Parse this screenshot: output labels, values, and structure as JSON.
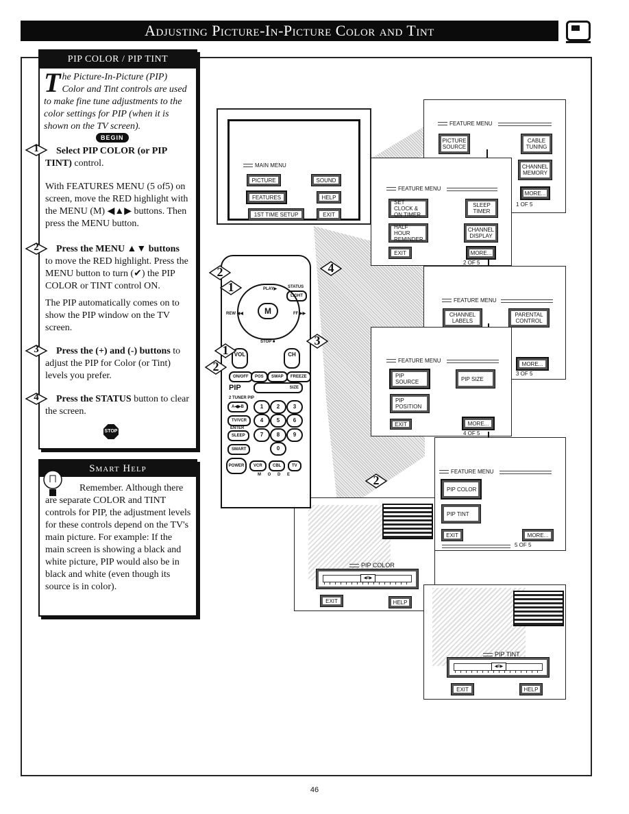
{
  "header": {
    "title": "Adjusting Picture-In-Picture Color and Tint",
    "icon": "tv-icon"
  },
  "instructions": {
    "title": "PIP COLOR / PIP TINT",
    "intro_dropcap": "T",
    "intro": "he Picture-In-Picture (PIP) Color and Tint controls are used to make fine tune adjustments to the color settings for PIP (when it is shown on the TV screen).",
    "begin_label": "BEGIN",
    "steps": [
      {
        "num": "1",
        "heading": "Select PIP COLOR (or PIP TINT)",
        "heading_rest": " control.",
        "body": "With FEATURES MENU (5 of5) on screen, move the RED highlight with the MENU (M) ◀▲▶ buttons. Then press the MENU button."
      },
      {
        "num": "2",
        "heading": "Press the MENU ▲▼ buttons",
        "body": "to move the RED highlight. Press the MENU button to turn (✔) the PIP COLOR or TINT control ON.",
        "body2": "The PIP automatically comes on to show the PIP window on the TV screen."
      },
      {
        "num": "3",
        "heading": "Press the (+) and (-) buttons",
        "heading_rest": " to adjust the PIP for Color (or Tint) levels you prefer."
      },
      {
        "num": "4",
        "heading": "Press the STATUS",
        "heading_rest": " button to clear the screen."
      }
    ],
    "stop_label": "STOP"
  },
  "smart_help": {
    "title": "Smart Help",
    "text": "Remember. Although there are separate COLOR and TINT controls for PIP, the adjustment levels for these controls depend on the TV's main picture. For example: If the main screen is showing a black and white picture, PIP would also be in black and white (even though its source is in color)."
  },
  "main_menu": {
    "title": "MAIN MENU",
    "buttons": [
      "PICTURE",
      "SOUND",
      "FEATURES",
      "HELP",
      "1ST TIME SETUP",
      "EXIT"
    ],
    "highlighted": "FEATURES"
  },
  "feature_menus": [
    {
      "title": "FEATURE MENU",
      "buttons": [
        "PICTURE SOURCE",
        "CABLE TUNING",
        "CHANNEL MEMORY",
        "MORE..."
      ],
      "pager": "1 OF 5",
      "highlighted": "MORE..."
    },
    {
      "title": "FEATURE MENU",
      "buttons": [
        "SET CLOCK & ON TIMER",
        "SLEEP TIMER",
        "HALF HOUR REMINDER",
        "CHANNEL DISPLAY",
        "EXIT",
        "MORE..."
      ],
      "pager": "2 OF 5",
      "highlighted": "MORE..."
    },
    {
      "title": "FEATURE MENU",
      "buttons": [
        "CHANNEL LABELS",
        "PARENTAL CONTROL",
        "MORE..."
      ],
      "pager": "3 OF 5",
      "highlighted": "MORE..."
    },
    {
      "title": "FEATURE MENU",
      "buttons": [
        "PIP SOURCE",
        "PIP SIZE",
        "PIP POSITION",
        "EXIT",
        "MORE..."
      ],
      "pager": "4 OF 5",
      "highlighted": "MORE..."
    },
    {
      "title": "FEATURE MENU",
      "buttons": [
        "PIP COLOR",
        "PIP TINT",
        "EXIT",
        "MORE..."
      ],
      "pager": "5 OF 5",
      "highlighted": "PIP COLOR"
    }
  ],
  "pip_color_screen": {
    "label": "PIP COLOR",
    "exit": "EXIT",
    "help": "HELP",
    "slider_thumb": "◀II▶",
    "slider_value": 0.5
  },
  "pip_tint_screen": {
    "label": "PIP TINT",
    "exit": "EXIT",
    "help": "HELP",
    "slider_thumb": "◀II▶",
    "slider_value": 0.5
  },
  "remote": {
    "labels": {
      "play": "PLAY▶",
      "status": "STATUS",
      "light": "LIGHT",
      "rew": "REW ◀◀",
      "ff": "FF ▶▶",
      "stop": "STOP ■",
      "menu": "M",
      "vol": "VOL",
      "ch": "CH"
    },
    "pip_row": [
      "ON/OFF",
      "POS",
      "SWAP",
      "FREEZE"
    ],
    "pip_label": "PIP",
    "size_label": "SIZE",
    "tuner_label": "2 TUNER PIP",
    "digits": [
      "1",
      "2",
      "3",
      "4",
      "5",
      "6",
      "7",
      "8",
      "9",
      "0"
    ],
    "side_keys": [
      "A◀▶B",
      "TV/VCR",
      "SLEEP",
      "SMART"
    ],
    "enter_label": "ENTER",
    "power": "POWER",
    "modes": [
      "VCR",
      "CBL",
      "TV"
    ],
    "mode_label": "M O D E",
    "callouts": [
      "1",
      "2",
      "3",
      "4"
    ]
  },
  "footer": {
    "page_number": "46"
  }
}
